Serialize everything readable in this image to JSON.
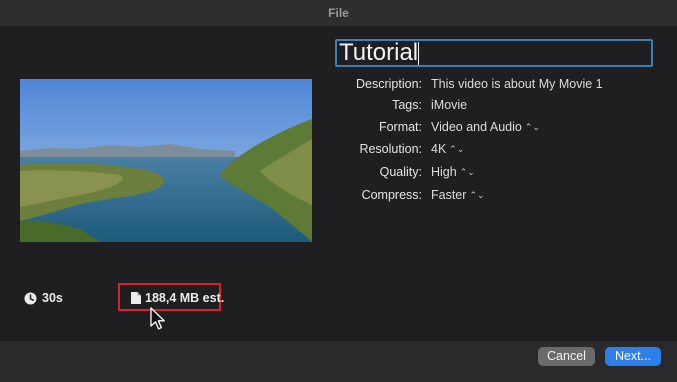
{
  "window": {
    "title": "File"
  },
  "share": {
    "title_value": "Tutorial",
    "fields": [
      {
        "label": "Description:",
        "value": "This video is about My Movie 1",
        "popup": false
      },
      {
        "label": "Tags:",
        "value": "iMovie",
        "popup": false
      },
      {
        "label": "Format:",
        "value": "Video and Audio",
        "popup": true
      },
      {
        "label": "Resolution:",
        "value": "4K",
        "popup": true
      },
      {
        "label": "Quality:",
        "value": "High",
        "popup": true
      },
      {
        "label": "Compress:",
        "value": "Faster",
        "popup": true
      }
    ],
    "popup_glyph": "⌃⌄"
  },
  "footer": {
    "duration": "30s",
    "estimate": "188,4 MB est.",
    "cancel_label": "Cancel",
    "next_label": "Next..."
  },
  "icons": {
    "duration": "clock-icon",
    "estimate": "file-icon",
    "pointer": "mouse-pointer-icon"
  },
  "colors": {
    "accent": "#2f7fe8",
    "focus_ring": "#3c7fb8",
    "highlight_box": "#d8232a"
  }
}
